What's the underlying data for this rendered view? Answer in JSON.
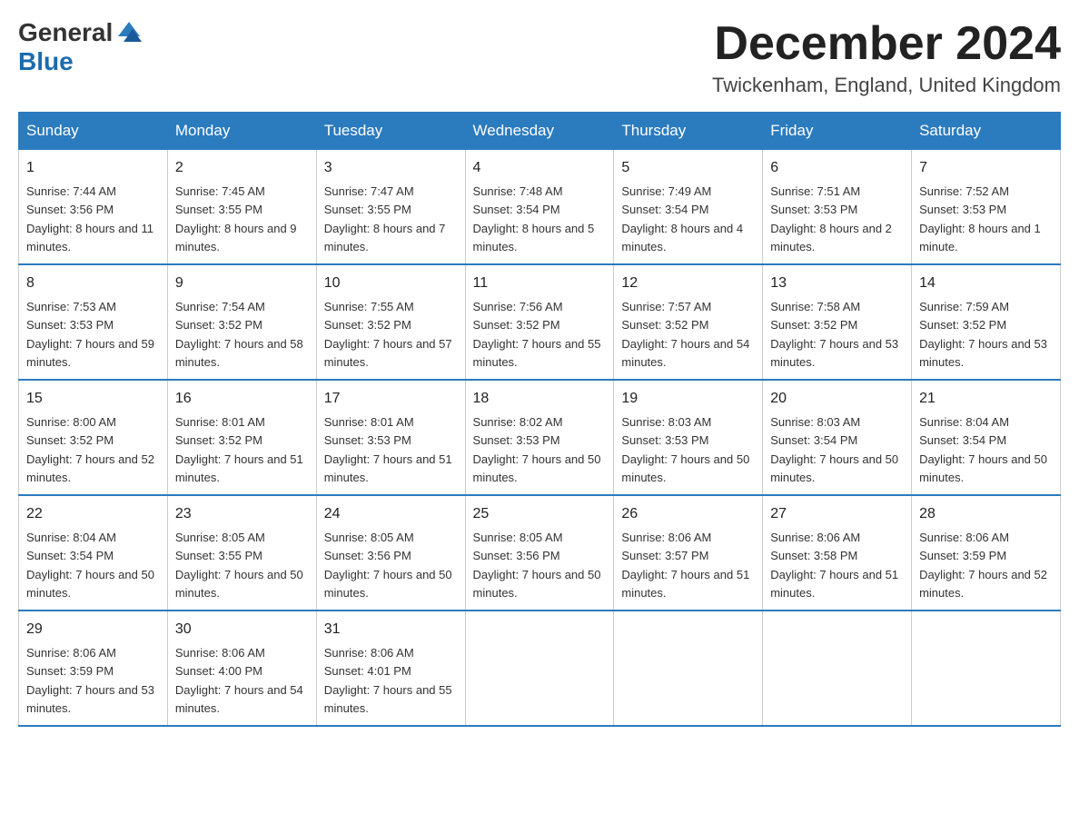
{
  "header": {
    "logo_text_general": "General",
    "logo_text_blue": "Blue",
    "month_title": "December 2024",
    "location": "Twickenham, England, United Kingdom"
  },
  "weekdays": [
    "Sunday",
    "Monday",
    "Tuesday",
    "Wednesday",
    "Thursday",
    "Friday",
    "Saturday"
  ],
  "weeks": [
    [
      {
        "day": "1",
        "sunrise": "7:44 AM",
        "sunset": "3:56 PM",
        "daylight": "8 hours and 11 minutes."
      },
      {
        "day": "2",
        "sunrise": "7:45 AM",
        "sunset": "3:55 PM",
        "daylight": "8 hours and 9 minutes."
      },
      {
        "day": "3",
        "sunrise": "7:47 AM",
        "sunset": "3:55 PM",
        "daylight": "8 hours and 7 minutes."
      },
      {
        "day": "4",
        "sunrise": "7:48 AM",
        "sunset": "3:54 PM",
        "daylight": "8 hours and 5 minutes."
      },
      {
        "day": "5",
        "sunrise": "7:49 AM",
        "sunset": "3:54 PM",
        "daylight": "8 hours and 4 minutes."
      },
      {
        "day": "6",
        "sunrise": "7:51 AM",
        "sunset": "3:53 PM",
        "daylight": "8 hours and 2 minutes."
      },
      {
        "day": "7",
        "sunrise": "7:52 AM",
        "sunset": "3:53 PM",
        "daylight": "8 hours and 1 minute."
      }
    ],
    [
      {
        "day": "8",
        "sunrise": "7:53 AM",
        "sunset": "3:53 PM",
        "daylight": "7 hours and 59 minutes."
      },
      {
        "day": "9",
        "sunrise": "7:54 AM",
        "sunset": "3:52 PM",
        "daylight": "7 hours and 58 minutes."
      },
      {
        "day": "10",
        "sunrise": "7:55 AM",
        "sunset": "3:52 PM",
        "daylight": "7 hours and 57 minutes."
      },
      {
        "day": "11",
        "sunrise": "7:56 AM",
        "sunset": "3:52 PM",
        "daylight": "7 hours and 55 minutes."
      },
      {
        "day": "12",
        "sunrise": "7:57 AM",
        "sunset": "3:52 PM",
        "daylight": "7 hours and 54 minutes."
      },
      {
        "day": "13",
        "sunrise": "7:58 AM",
        "sunset": "3:52 PM",
        "daylight": "7 hours and 53 minutes."
      },
      {
        "day": "14",
        "sunrise": "7:59 AM",
        "sunset": "3:52 PM",
        "daylight": "7 hours and 53 minutes."
      }
    ],
    [
      {
        "day": "15",
        "sunrise": "8:00 AM",
        "sunset": "3:52 PM",
        "daylight": "7 hours and 52 minutes."
      },
      {
        "day": "16",
        "sunrise": "8:01 AM",
        "sunset": "3:52 PM",
        "daylight": "7 hours and 51 minutes."
      },
      {
        "day": "17",
        "sunrise": "8:01 AM",
        "sunset": "3:53 PM",
        "daylight": "7 hours and 51 minutes."
      },
      {
        "day": "18",
        "sunrise": "8:02 AM",
        "sunset": "3:53 PM",
        "daylight": "7 hours and 50 minutes."
      },
      {
        "day": "19",
        "sunrise": "8:03 AM",
        "sunset": "3:53 PM",
        "daylight": "7 hours and 50 minutes."
      },
      {
        "day": "20",
        "sunrise": "8:03 AM",
        "sunset": "3:54 PM",
        "daylight": "7 hours and 50 minutes."
      },
      {
        "day": "21",
        "sunrise": "8:04 AM",
        "sunset": "3:54 PM",
        "daylight": "7 hours and 50 minutes."
      }
    ],
    [
      {
        "day": "22",
        "sunrise": "8:04 AM",
        "sunset": "3:54 PM",
        "daylight": "7 hours and 50 minutes."
      },
      {
        "day": "23",
        "sunrise": "8:05 AM",
        "sunset": "3:55 PM",
        "daylight": "7 hours and 50 minutes."
      },
      {
        "day": "24",
        "sunrise": "8:05 AM",
        "sunset": "3:56 PM",
        "daylight": "7 hours and 50 minutes."
      },
      {
        "day": "25",
        "sunrise": "8:05 AM",
        "sunset": "3:56 PM",
        "daylight": "7 hours and 50 minutes."
      },
      {
        "day": "26",
        "sunrise": "8:06 AM",
        "sunset": "3:57 PM",
        "daylight": "7 hours and 51 minutes."
      },
      {
        "day": "27",
        "sunrise": "8:06 AM",
        "sunset": "3:58 PM",
        "daylight": "7 hours and 51 minutes."
      },
      {
        "day": "28",
        "sunrise": "8:06 AM",
        "sunset": "3:59 PM",
        "daylight": "7 hours and 52 minutes."
      }
    ],
    [
      {
        "day": "29",
        "sunrise": "8:06 AM",
        "sunset": "3:59 PM",
        "daylight": "7 hours and 53 minutes."
      },
      {
        "day": "30",
        "sunrise": "8:06 AM",
        "sunset": "4:00 PM",
        "daylight": "7 hours and 54 minutes."
      },
      {
        "day": "31",
        "sunrise": "8:06 AM",
        "sunset": "4:01 PM",
        "daylight": "7 hours and 55 minutes."
      },
      null,
      null,
      null,
      null
    ]
  ]
}
